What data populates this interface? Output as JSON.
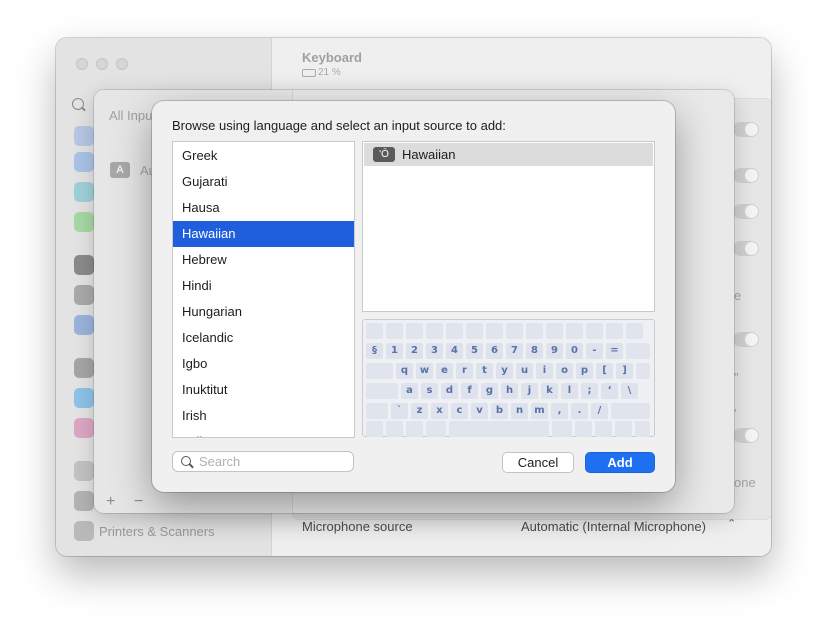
{
  "window": {
    "title": "Keyboard",
    "battery_text": "21 %",
    "sidebar_bottom_item": "Printers & Scanners"
  },
  "behind_sheet": {
    "search_text": "All Inpu",
    "list_item_abbrev": "A",
    "list_item_text": "Au",
    "plus_label": "+",
    "minus_label": "−"
  },
  "main_bg": {
    "dropdown_1_suffix": "e",
    "dropdown_2_suffix": "\"",
    "dropdown_3_suffix": "'",
    "done_button_partial": "one",
    "microphone_label": "Microphone source",
    "microphone_value": "Automatic (Internal Microphone)"
  },
  "dialog": {
    "prompt": "Browse using language and select an input source to add:",
    "languages": [
      "Greek",
      "Gujarati",
      "Hausa",
      "Hawaiian",
      "Hebrew",
      "Hindi",
      "Hungarian",
      "Icelandic",
      "Igbo",
      "Inuktitut",
      "Irish",
      "Italian"
    ],
    "selected_language": "Hawaiian",
    "sources": [
      {
        "icon_text": "'Ō",
        "label": "Hawaiian"
      }
    ],
    "search_placeholder": "Search",
    "cancel_label": "Cancel",
    "add_label": "Add"
  },
  "keyboard": {
    "row1": [
      "§",
      "1",
      "2",
      "3",
      "4",
      "5",
      "6",
      "7",
      "8",
      "9",
      "0",
      "-",
      "="
    ],
    "row2": [
      "q",
      "w",
      "e",
      "r",
      "t",
      "y",
      "u",
      "i",
      "o",
      "p",
      "[",
      "]"
    ],
    "row3": [
      "a",
      "s",
      "d",
      "f",
      "g",
      "h",
      "j",
      "k",
      "l",
      ";",
      "ʻ",
      "\\"
    ],
    "row4": [
      "`",
      "z",
      "x",
      "c",
      "v",
      "b",
      "n",
      "m",
      ",",
      ".",
      "/"
    ]
  },
  "colors": {
    "accent": "#1f6ff2",
    "selection": "#1f5fde",
    "key_text": "#5a72a8"
  }
}
